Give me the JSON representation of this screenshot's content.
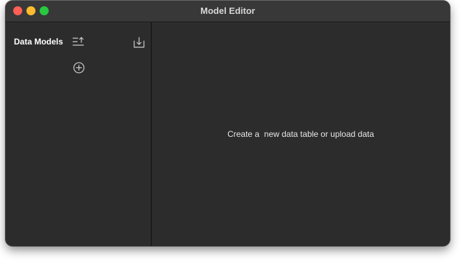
{
  "window": {
    "title": "Model Editor"
  },
  "sidebar": {
    "title": "Data Models",
    "icons": [
      "sort-upload-icon",
      "download-icon",
      "add-circle-icon"
    ]
  },
  "main": {
    "empty_message": "Create a  new data table or upload data"
  },
  "colors": {
    "window_bg": "#2c2c2c",
    "titlebar_bg": "#383838",
    "close": "#fe5f57",
    "minimize": "#febc2e",
    "zoom": "#28c840",
    "text": "#ffffff"
  }
}
